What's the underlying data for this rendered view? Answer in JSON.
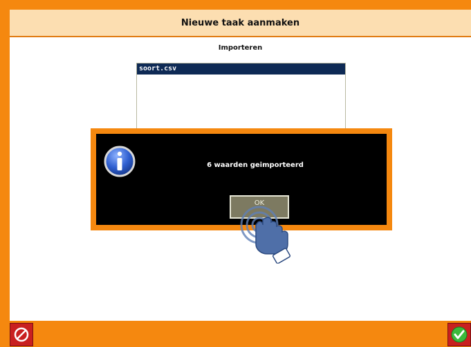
{
  "window": {
    "title": "Nieuwe taak aanmaken"
  },
  "main": {
    "section_title": "Importeren",
    "files": [
      {
        "name": "soort.csv",
        "selected": true
      }
    ]
  },
  "dialog": {
    "icon": "info-icon",
    "message": "6 waarden geimporteerd",
    "ok_label": "OK"
  },
  "footer": {
    "cancel_icon": "cancel-icon",
    "confirm_icon": "checkmark-icon"
  },
  "colors": {
    "frame": "#f5880f",
    "header_bg": "#fcdeb1",
    "list_selection": "#0e2a55",
    "dialog_bg": "#000000",
    "ok_button": "#7d7a61",
    "footer_button": "#c92020",
    "confirm_check": "#3cb93c"
  }
}
